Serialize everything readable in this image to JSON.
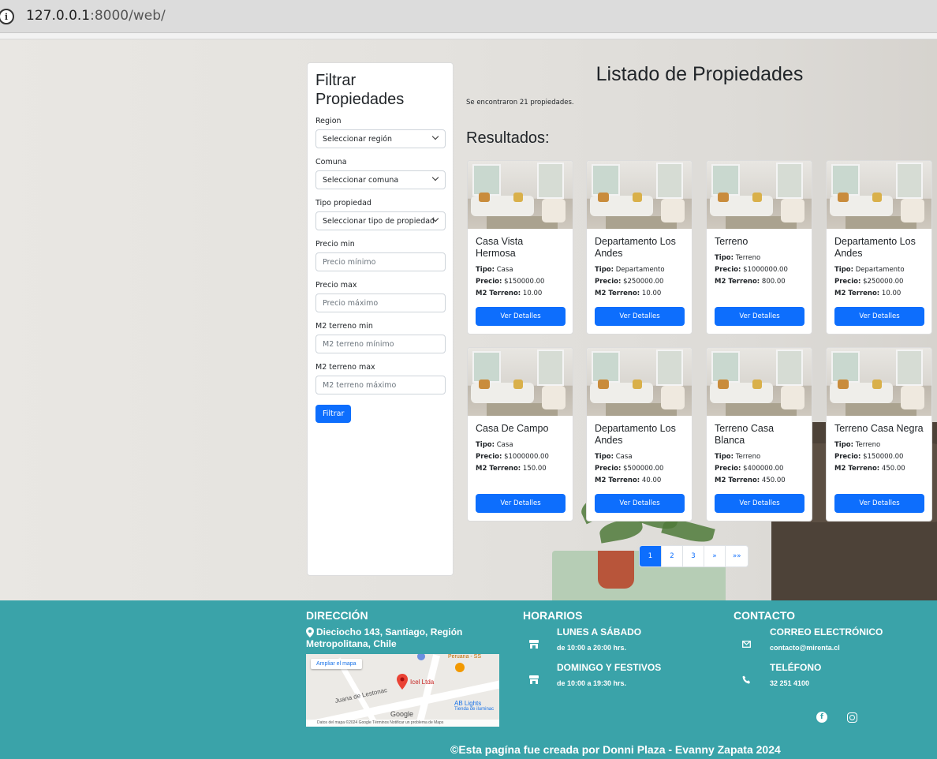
{
  "browser": {
    "url_host": "127.0.0.1",
    "url_rest": ":8000/web/"
  },
  "sidebar": {
    "title": "Filtrar Propiedades",
    "fields": [
      {
        "label": "Region",
        "type": "select",
        "value": "Seleccionar región"
      },
      {
        "label": "Comuna",
        "type": "select",
        "value": "Seleccionar comuna"
      },
      {
        "label": "Tipo propiedad",
        "type": "select",
        "value": "Seleccionar tipo de propiedad"
      },
      {
        "label": "Precio min",
        "type": "input",
        "placeholder": "Precio mínimo"
      },
      {
        "label": "Precio max",
        "type": "input",
        "placeholder": "Precio máximo"
      },
      {
        "label": "M2 terreno min",
        "type": "input",
        "placeholder": "M2 terreno mínimo"
      },
      {
        "label": "M2 terreno max",
        "type": "input",
        "placeholder": "M2 terreno máximo"
      }
    ],
    "button": "Filtrar"
  },
  "main": {
    "title": "Listado de Propiedades",
    "count_text": "Se encontraron 21 propiedades.",
    "results_label": "Resultados:",
    "field_labels": {
      "tipo": "Tipo:",
      "precio": "Precio:",
      "m2": "M2 Terreno:"
    },
    "button_label": "Ver Detalles",
    "properties": [
      {
        "title": "Casa Vista Hermosa",
        "tipo": "Casa",
        "precio": "$150000.00",
        "m2": "10.00"
      },
      {
        "title": "Departamento Los Andes",
        "tipo": "Departamento",
        "precio": "$250000.00",
        "m2": "10.00"
      },
      {
        "title": "Terreno",
        "tipo": "Terreno",
        "precio": "$1000000.00",
        "m2": "800.00"
      },
      {
        "title": "Departamento Los Andes",
        "tipo": "Departamento",
        "precio": "$250000.00",
        "m2": "10.00"
      },
      {
        "title": "Casa De Campo",
        "tipo": "Casa",
        "precio": "$1000000.00",
        "m2": "150.00"
      },
      {
        "title": "Departamento Los Andes",
        "tipo": "Casa",
        "precio": "$500000.00",
        "m2": "40.00"
      },
      {
        "title": "Terreno Casa Blanca",
        "tipo": "Terreno",
        "precio": "$400000.00",
        "m2": "450.00"
      },
      {
        "title": "Terreno Casa Negra",
        "tipo": "Terreno",
        "precio": "$150000.00",
        "m2": "450.00"
      }
    ]
  },
  "pagination": {
    "pages": [
      "1",
      "2",
      "3",
      "»",
      "»»"
    ],
    "active": "1"
  },
  "footer": {
    "direccion": {
      "heading": "DIRECCIÓN",
      "address": "Dieciocho 143, Santiago, Región Metropolitana, Chile",
      "map": {
        "button": "Ampliar el mapa",
        "marker_label": "Icel Ltda",
        "street": "Juana de Lestonac",
        "poi_1": "Peruana - SS",
        "poi_2": "AB Lights",
        "poi_2_sub": "Tienda de iluminac",
        "google": "Google",
        "attribution": "Datos del mapa ©2024 Google   Términos   Notificar un problema de Maps"
      }
    },
    "horarios": {
      "heading": "HORARIOS",
      "items": [
        {
          "day": "LUNES A SÁBADO",
          "hours": "de 10:00 a 20:00 hrs."
        },
        {
          "day": "DOMINGO Y FESTIVOS",
          "hours": "de 10:00 a 19:30 hrs."
        }
      ]
    },
    "contacto": {
      "heading": "CONTACTO",
      "email_label": "CORREO ELECTRÓNICO",
      "email": "contacto@mirenta.cl",
      "phone_label": "TELÉFONO",
      "phone": "32 251 4100"
    },
    "copyright": "©Esta pagína fue creada por Donni Plaza - Evanny Zapata 2024"
  },
  "colors": {
    "primary": "#0d6efd",
    "footer_bg": "#3aa3a9"
  }
}
